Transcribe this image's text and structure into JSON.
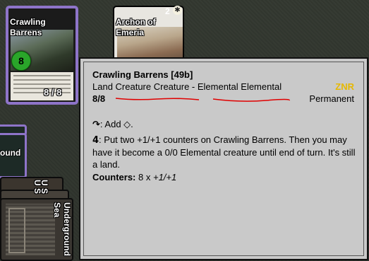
{
  "board": {
    "cards": [
      {
        "name": "Crawling Barrens",
        "counter": "8",
        "pt": "8 / 8",
        "selected": true
      },
      {
        "name": "Archon of Emeria",
        "badge": "2"
      }
    ],
    "left_stack": {
      "band_text": "ound",
      "land_texts": [
        "U",
        "U",
        "S",
        "S",
        "Underground Sea"
      ]
    }
  },
  "tooltip": {
    "name": "Crawling Barrens [49b]",
    "type_line": "Land Creature Creature - Elemental Elemental",
    "set_code": "ZNR",
    "pt": "8/8",
    "kind": "Permanent",
    "rule1_text": ": Add",
    "rule1_end": ".",
    "rule2_cost": "4",
    "rule2_text": ": Put two +1/+1 counters on Crawling Barrens. Then you may have it become a 0/0 Elemental creature until end of turn. It's still a land.",
    "counters_label": "Counters:",
    "counters_value": "8 x ",
    "counters_type": "+1/+1"
  },
  "colors": {
    "selection": "#8e74c9",
    "set_rarity": "#e6b800",
    "counter": "#2aa52a",
    "annotation": "#e00000"
  },
  "icons": {
    "tap": "tap-symbol-icon",
    "mana": "colorless-mana-icon",
    "sun": "sun-icon"
  }
}
